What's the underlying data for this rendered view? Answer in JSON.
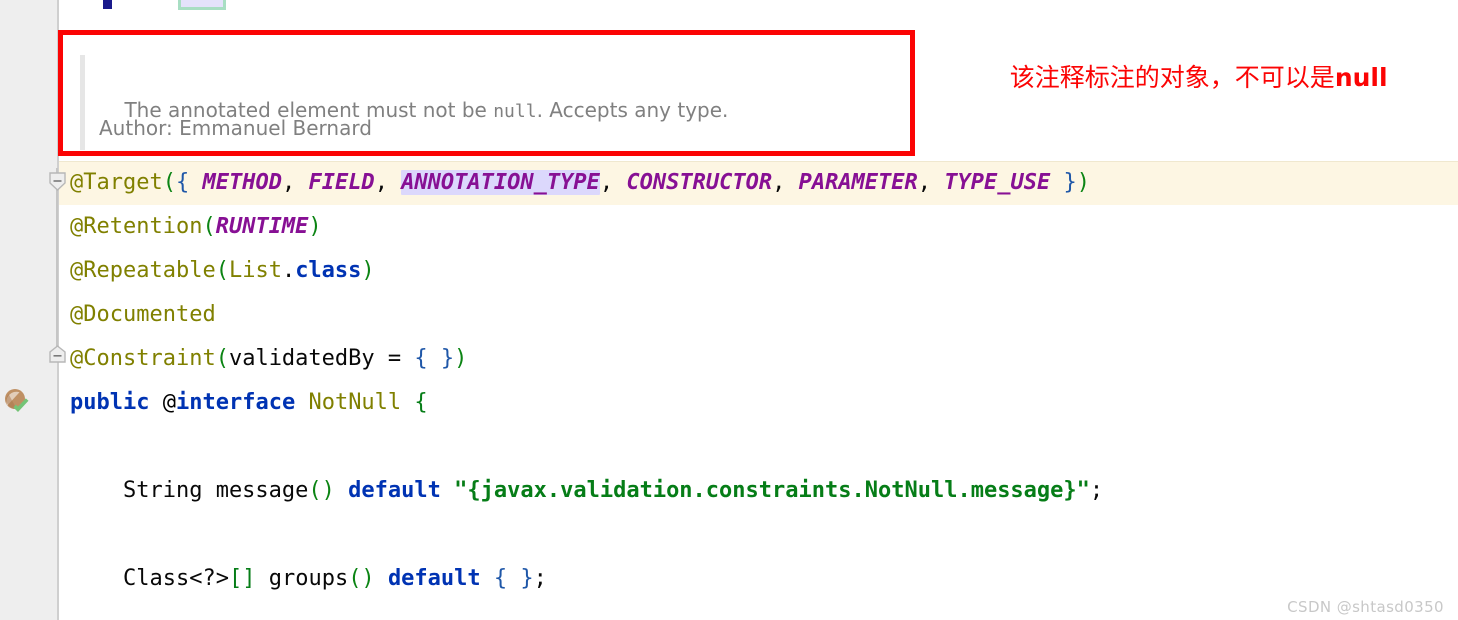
{
  "editor": {
    "gutter_icon_name": "bean-with-check-icon",
    "fold_markers": [
      "fold-collapse-target",
      "fold-collapse-constraint"
    ],
    "current_line_index": 0,
    "lines": [
      {
        "id": "line-target",
        "highlighted": true,
        "tokens": [
          {
            "text": "@Target",
            "cls": "t-ann"
          },
          {
            "text": "(",
            "cls": "t-paren"
          },
          {
            "text": "{ ",
            "cls": "t-brace"
          },
          {
            "text": "METHOD",
            "cls": "t-const"
          },
          {
            "text": ", ",
            "cls": "t-punct"
          },
          {
            "text": "FIELD",
            "cls": "t-const"
          },
          {
            "text": ", ",
            "cls": "t-punct"
          },
          {
            "text": "ANNOTATION_TYPE",
            "cls": "t-const hl-token"
          },
          {
            "text": ", ",
            "cls": "t-punct"
          },
          {
            "text": "CONSTRUCTOR",
            "cls": "t-const"
          },
          {
            "text": ", ",
            "cls": "t-punct"
          },
          {
            "text": "PARAMETER",
            "cls": "t-const"
          },
          {
            "text": ", ",
            "cls": "t-punct"
          },
          {
            "text": "TYPE_USE",
            "cls": "t-const"
          },
          {
            "text": " }",
            "cls": "t-brace"
          },
          {
            "text": ")",
            "cls": "t-paren"
          }
        ]
      },
      {
        "id": "line-retention",
        "highlighted": false,
        "tokens": [
          {
            "text": "@Retention",
            "cls": "t-ann"
          },
          {
            "text": "(",
            "cls": "t-paren"
          },
          {
            "text": "RUNTIME",
            "cls": "t-const"
          },
          {
            "text": ")",
            "cls": "t-paren"
          }
        ]
      },
      {
        "id": "line-repeatable",
        "highlighted": false,
        "tokens": [
          {
            "text": "@Repeatable",
            "cls": "t-ann"
          },
          {
            "text": "(",
            "cls": "t-paren"
          },
          {
            "text": "List",
            "cls": "t-ann"
          },
          {
            "text": ".",
            "cls": "t-punct"
          },
          {
            "text": "class",
            "cls": "t-kw"
          },
          {
            "text": ")",
            "cls": "t-paren"
          }
        ]
      },
      {
        "id": "line-documented",
        "highlighted": false,
        "tokens": [
          {
            "text": "@Documented",
            "cls": "t-ann"
          }
        ]
      },
      {
        "id": "line-constraint",
        "highlighted": false,
        "tokens": [
          {
            "text": "@Constraint",
            "cls": "t-ann"
          },
          {
            "text": "(",
            "cls": "t-paren"
          },
          {
            "text": "validatedBy",
            "cls": "t-plain"
          },
          {
            "text": " = ",
            "cls": "t-punct"
          },
          {
            "text": "{ }",
            "cls": "t-brace"
          },
          {
            "text": ")",
            "cls": "t-paren"
          }
        ]
      },
      {
        "id": "line-interface",
        "highlighted": false,
        "tokens": [
          {
            "text": "public",
            "cls": "t-kw"
          },
          {
            "text": " ",
            "cls": "t-punct"
          },
          {
            "text": "@",
            "cls": "t-at"
          },
          {
            "text": "interface",
            "cls": "t-kw"
          },
          {
            "text": " ",
            "cls": "t-punct"
          },
          {
            "text": "NotNull",
            "cls": "t-typename"
          },
          {
            "text": " ",
            "cls": "t-punct"
          },
          {
            "text": "{",
            "cls": "t-green"
          }
        ]
      },
      {
        "id": "line-blank-1",
        "highlighted": false,
        "tokens": []
      },
      {
        "id": "line-message",
        "highlighted": false,
        "tokens": [
          {
            "text": "    String message",
            "cls": "t-plain"
          },
          {
            "text": "()",
            "cls": "t-paren"
          },
          {
            "text": " ",
            "cls": "t-punct"
          },
          {
            "text": "default",
            "cls": "t-kw"
          },
          {
            "text": " ",
            "cls": "t-punct"
          },
          {
            "text": "\"{javax.validation.constraints.NotNull.message}\"",
            "cls": "t-str"
          },
          {
            "text": ";",
            "cls": "t-punct"
          }
        ]
      },
      {
        "id": "line-blank-2",
        "highlighted": false,
        "tokens": []
      },
      {
        "id": "line-groups",
        "highlighted": false,
        "tokens": [
          {
            "text": "    Class",
            "cls": "t-plain"
          },
          {
            "text": "<?>",
            "cls": "t-plain"
          },
          {
            "text": "[]",
            "cls": "t-green"
          },
          {
            "text": " groups",
            "cls": "t-plain"
          },
          {
            "text": "()",
            "cls": "t-paren"
          },
          {
            "text": " ",
            "cls": "t-punct"
          },
          {
            "text": "default",
            "cls": "t-kw"
          },
          {
            "text": " ",
            "cls": "t-punct"
          },
          {
            "text": "{ }",
            "cls": "t-brace"
          },
          {
            "text": ";",
            "cls": "t-punct"
          }
        ]
      }
    ]
  },
  "documentation_popup": {
    "line1_prefix": "The annotated element must not be ",
    "line1_code": "null",
    "line1_suffix": ". Accepts any type.",
    "line2": "Author: Emmanuel Bernard"
  },
  "annotation_note": {
    "text_normal": "该注释标注的对象，不可以是",
    "text_bold": "null",
    "color": "#fb0404"
  },
  "red_highlight_box": {
    "color": "#fb0404",
    "border_width_px": 5
  },
  "watermark": {
    "text": "CSDN @shtasd0350"
  },
  "colors": {
    "gutter_bg": "#eeeeee",
    "current_line_bg": "#fdf6e3",
    "selection_token_bg": "#dcd8fc",
    "annotation_yellow": "#808000",
    "keyword_blue": "#0033b3",
    "string_green": "#067d17",
    "constant_purple": "#871094",
    "paren_green": "#0b8413",
    "brace_blue": "#1f57a8"
  }
}
